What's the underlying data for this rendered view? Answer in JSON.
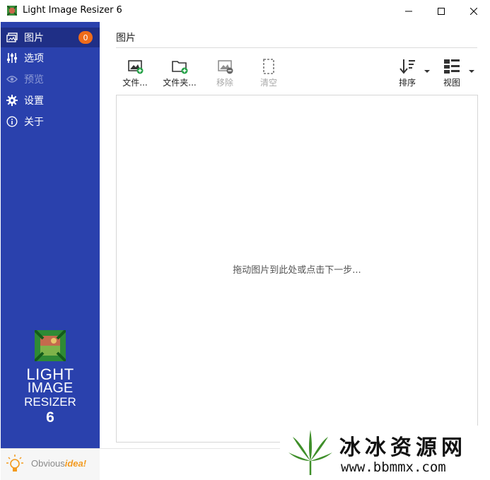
{
  "window": {
    "title": "Light Image Resizer 6"
  },
  "sidebar": {
    "items": [
      {
        "label": "图片",
        "icon": "pictures-icon",
        "active": true,
        "badge": "0"
      },
      {
        "label": "选项",
        "icon": "sliders-icon"
      },
      {
        "label": "预览",
        "icon": "eye-icon",
        "disabled": true
      },
      {
        "label": "设置",
        "icon": "gear-icon"
      },
      {
        "label": "关于",
        "icon": "info-icon"
      }
    ],
    "logo": {
      "line1": "LIGHT",
      "line2": "IMAGE",
      "line3": "RESIZER",
      "line4": "6"
    },
    "brand": {
      "part1": "Obvious",
      "part2": "idea!"
    }
  },
  "main": {
    "section_title": "图片",
    "toolbar": {
      "file": "文件...",
      "folder": "文件夹...",
      "remove": "移除",
      "clear": "清空",
      "sort": "排序",
      "view": "视图"
    },
    "drop_hint": "拖动图片到此处或点击下一步..."
  },
  "watermark": {
    "title": "冰冰资源网",
    "url": "www.bbmmx.com"
  },
  "colors": {
    "sidebar_bg": "#2a41ad",
    "sidebar_active": "#1f2f86",
    "badge": "#ef6c1a",
    "add_green": "#22a045"
  }
}
